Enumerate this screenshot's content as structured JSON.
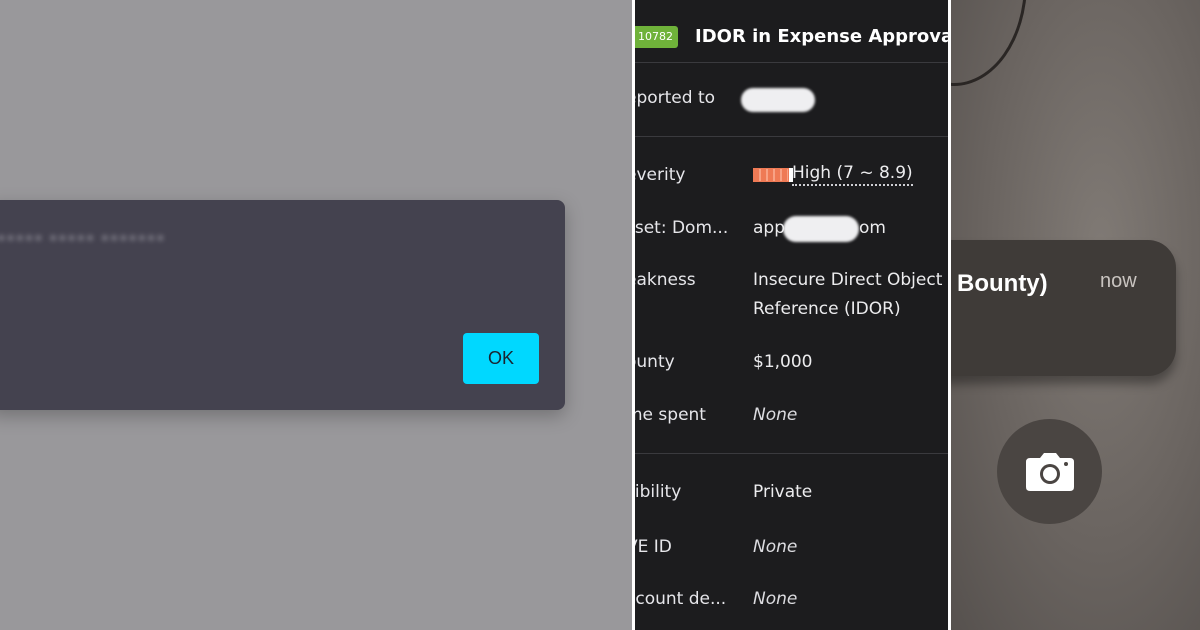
{
  "alert": {
    "message": "•••••• ••••• •••••••",
    "ok_label": "OK"
  },
  "report": {
    "badge": "10782",
    "title": "IDOR in Expense Approval",
    "rows": {
      "reported_to": {
        "label": "eported to"
      },
      "severity": {
        "label": "everity",
        "value": "High (7 ~ 8.9)"
      },
      "asset": {
        "label": "sset: Dom...",
        "value_prefix": "app",
        "value_suffix": "om"
      },
      "weakness": {
        "label": "eakness",
        "value_line1": "Insecure Direct Object",
        "value_line2": "Reference (IDOR)"
      },
      "bounty": {
        "label": "ounty",
        "value": "$1,000"
      },
      "time_spent": {
        "label": "me spent",
        "value": "None"
      },
      "visibility": {
        "label": "sibility",
        "value": "Private"
      },
      "cve_id": {
        "label": "VE ID",
        "value": "None"
      },
      "account": {
        "label": "ccount de...",
        "value": "None"
      }
    }
  },
  "notification": {
    "title": "Bounty)",
    "time": "now"
  },
  "colors": {
    "ok_button": "#00d8ff",
    "badge": "#6fb23a",
    "severity_high": "#ef7a55"
  },
  "icons": {
    "camera": "camera-icon"
  }
}
